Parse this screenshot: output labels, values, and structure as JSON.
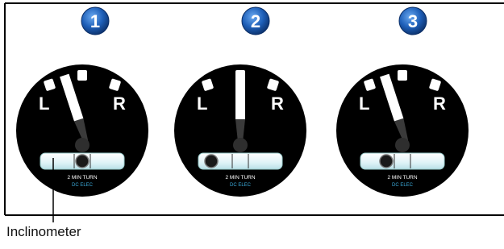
{
  "callout": {
    "label": "Inclinometer"
  },
  "gauges": [
    {
      "step": "1",
      "needle_deflection": "left",
      "ball": "center",
      "left_label": "L",
      "right_label": "R",
      "turn_text": "2 MIN TURN",
      "sub_text": "DC ELEC"
    },
    {
      "step": "2",
      "needle_deflection": "center",
      "ball": "left",
      "left_label": "L",
      "right_label": "R",
      "turn_text": "2 MIN TURN",
      "sub_text": "DC ELEC"
    },
    {
      "step": "3",
      "needle_deflection": "left",
      "ball": "center",
      "left_label": "L",
      "right_label": "R",
      "turn_text": "2 MIN TURN",
      "sub_text": "DC ELEC"
    }
  ],
  "colors": {
    "badge": "#1e5fb8",
    "dial": "#000000",
    "tube": "#dff3f7",
    "sub_text": "#3aa7d6"
  }
}
